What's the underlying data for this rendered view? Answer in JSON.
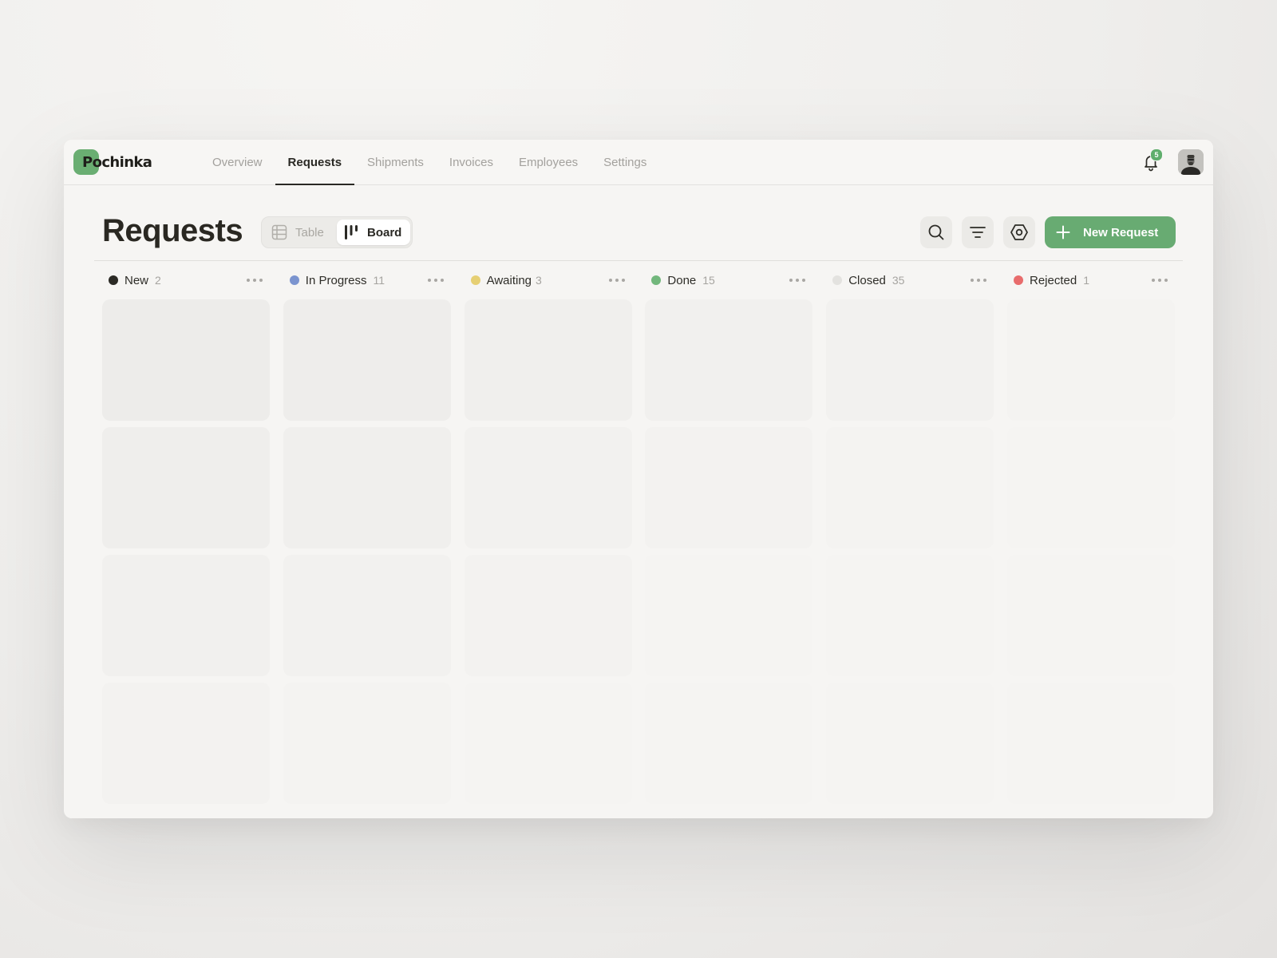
{
  "app": {
    "logo_text": "Pochinka",
    "brand_color": "#6aae72"
  },
  "nav": {
    "tabs": [
      {
        "label": "Overview",
        "active": false
      },
      {
        "label": "Requests",
        "active": true
      },
      {
        "label": "Shipments",
        "active": false
      },
      {
        "label": "Invoices",
        "active": false
      },
      {
        "label": "Employees",
        "active": false
      },
      {
        "label": "Settings",
        "active": false
      }
    ],
    "notifications_count": "5",
    "icons": [
      "bell-icon",
      "avatar"
    ]
  },
  "header": {
    "title": "Requests",
    "view_toggle": {
      "table_label": "Table",
      "board_label": "Board",
      "selected": "Board"
    },
    "actions": {
      "icons": [
        "search-icon",
        "filter-icon",
        "settings-icon",
        "plus-icon"
      ],
      "new_request_label": "New Request",
      "new_request_color": "#68ab72"
    }
  },
  "board": {
    "columns": [
      {
        "name": "New",
        "count": "2",
        "color": "#2b2a25"
      },
      {
        "name": "In Progress",
        "count": "11",
        "color": "#7b94cf"
      },
      {
        "name": "Awaiting",
        "count": "3",
        "color": "#e6cf73"
      },
      {
        "name": "Done",
        "count": "15",
        "color": "#72b77c"
      },
      {
        "name": "Closed",
        "count": "35",
        "color": "#e3e2df"
      },
      {
        "name": "Rejected",
        "count": "1",
        "color": "#e86c6c"
      }
    ]
  }
}
